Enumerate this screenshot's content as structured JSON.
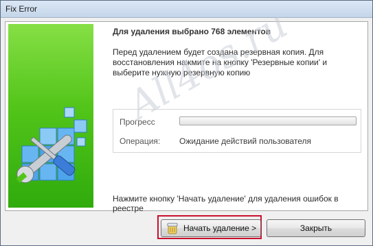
{
  "window": {
    "title": "Fix Error"
  },
  "banner": {
    "icon": "registry-repair-icon"
  },
  "main": {
    "heading": "Для удаления выбрано 768 элементов",
    "info_text": "Перед удалением будет создана резервная копия. Для восстановления нажмите на кнопку 'Резервные копии' и выберите нужную резервную копию",
    "progress_label": "Прогресс",
    "progress_value": 0,
    "operation_label": "Операция:",
    "operation_value": "Ожидание действий пользователя",
    "hint": "Нажмите кнопку 'Начать удаление' для удаления ошибок в реестре"
  },
  "watermark": {
    "text": "All4os.ru"
  },
  "buttons": {
    "start_label": "Начать удаление >",
    "start_icon": "recycle-bin-icon",
    "close_label": "Закрыть"
  },
  "colors": {
    "banner_green": "#53c51a",
    "highlight_red": "#c8102e"
  }
}
